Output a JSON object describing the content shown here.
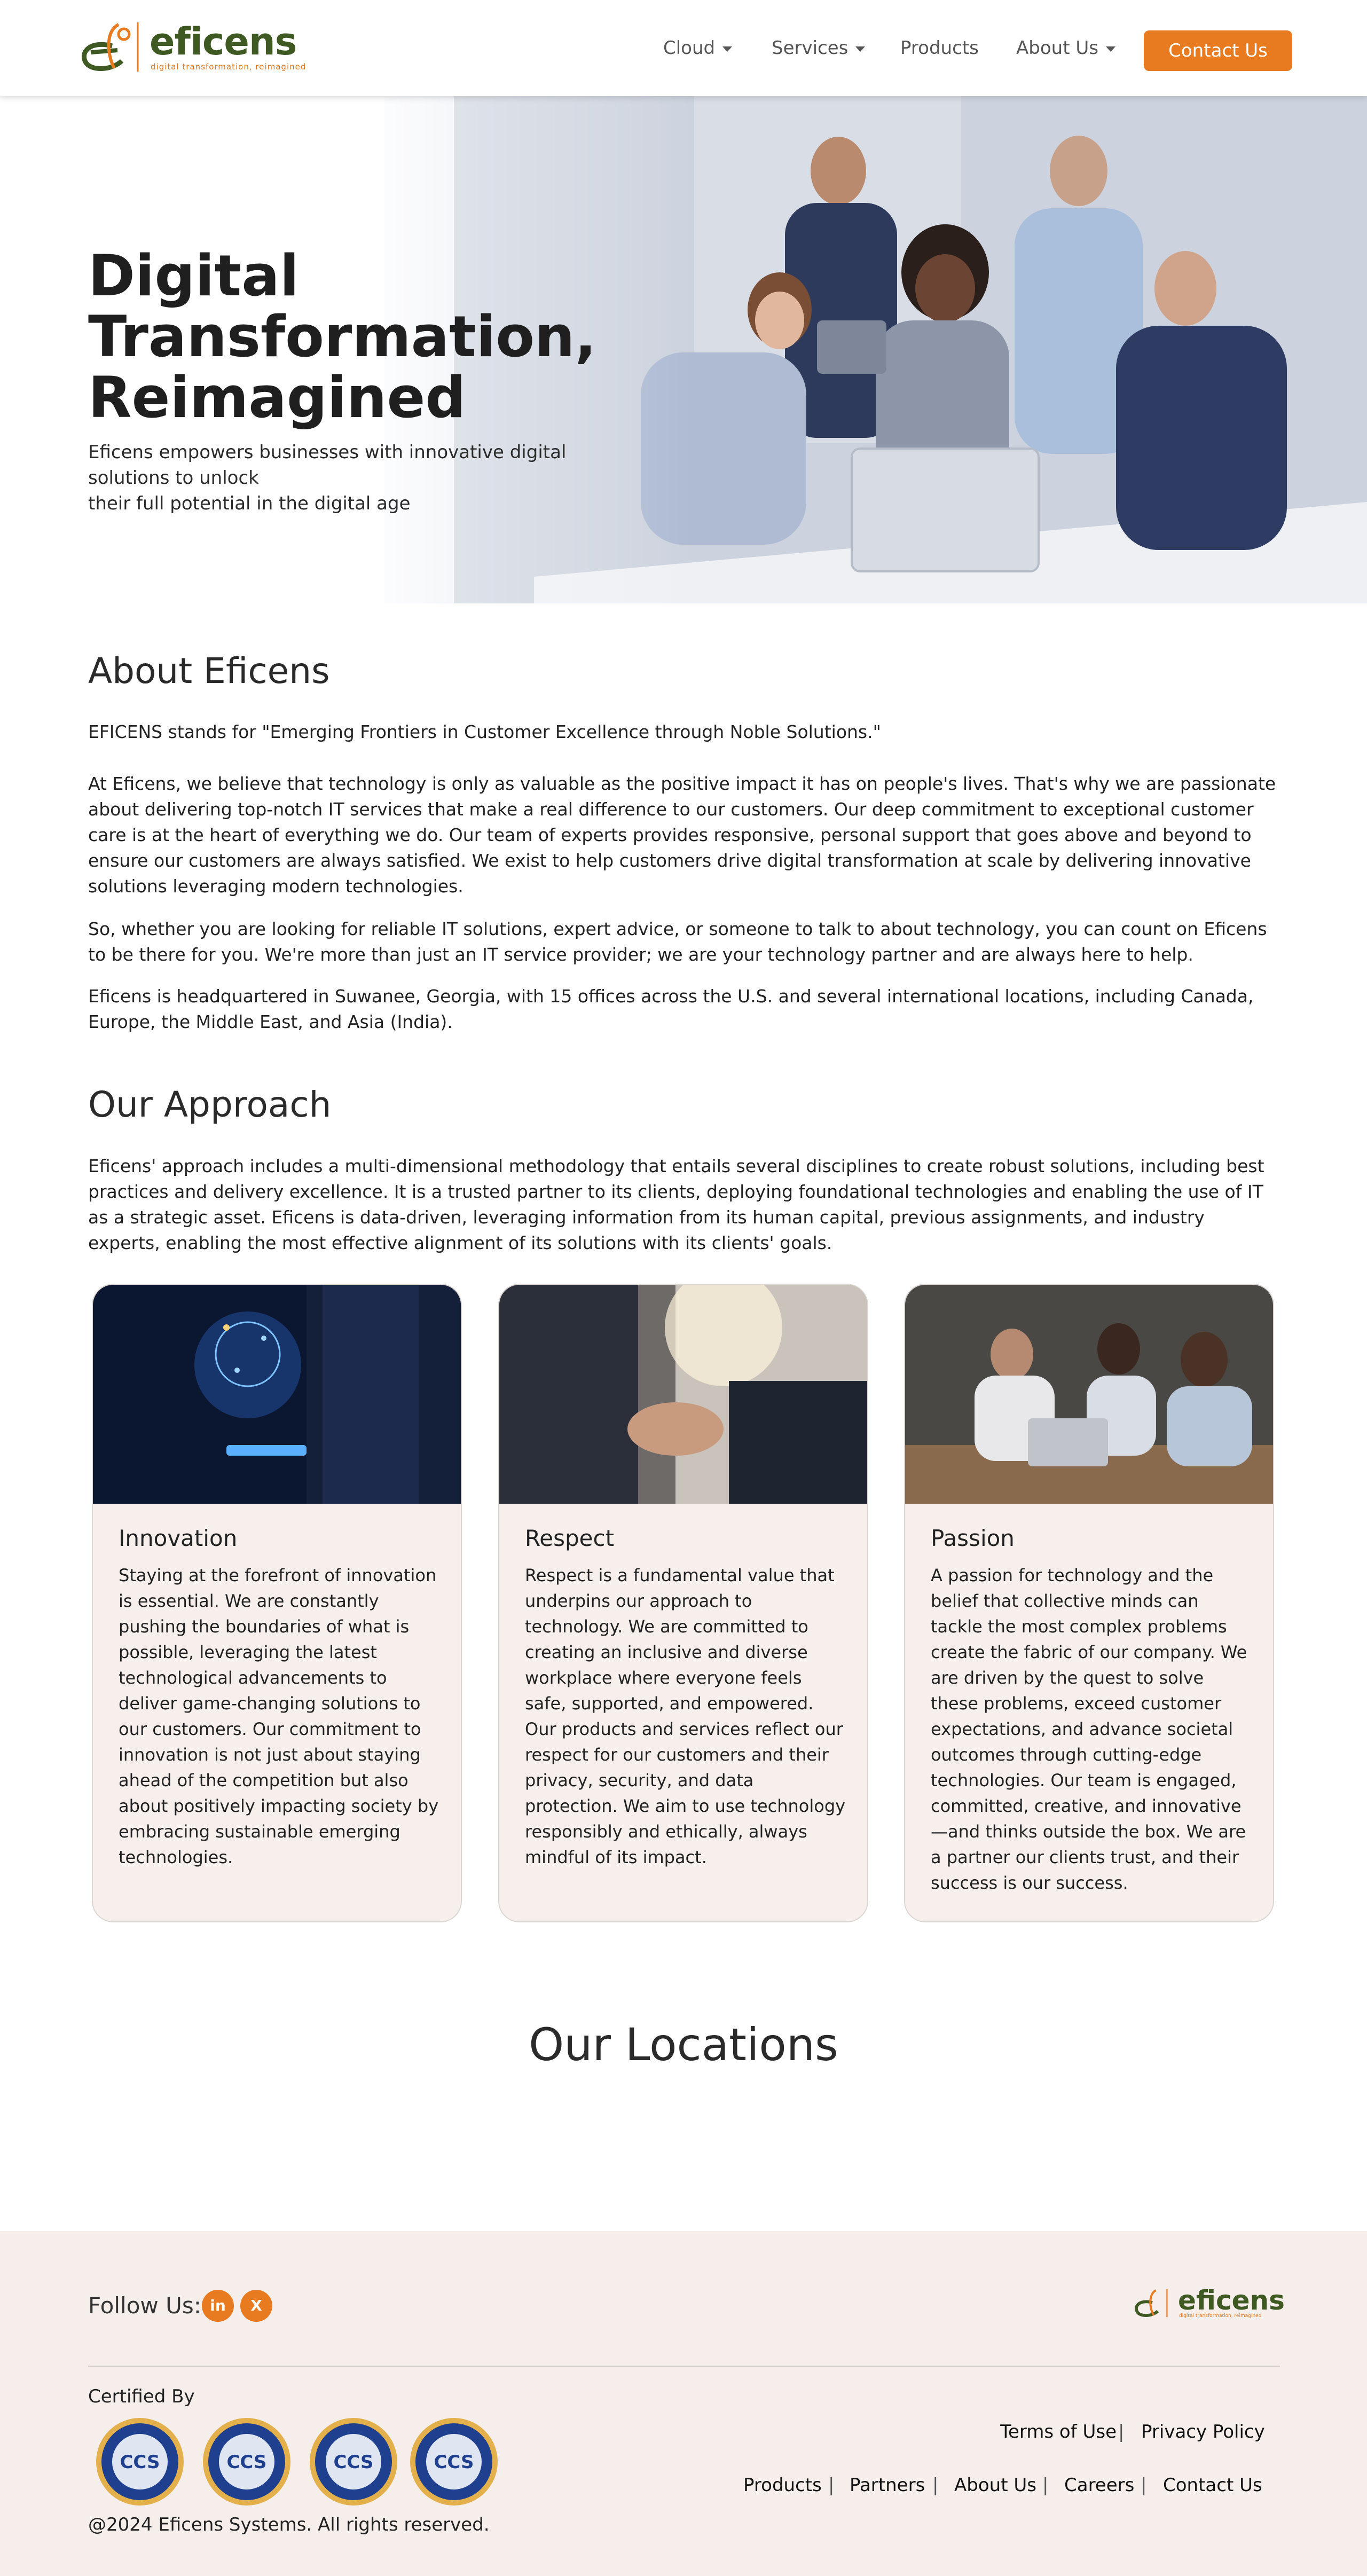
{
  "brand": {
    "name": "eficens",
    "tagline": "digital transformation, reimagined",
    "accent": "#e87a1f",
    "green": "#3e5a22"
  },
  "nav": {
    "items": [
      {
        "label": "Cloud",
        "dropdown": true
      },
      {
        "label": "Services",
        "dropdown": true
      },
      {
        "label": "Products",
        "dropdown": false
      },
      {
        "label": "About Us",
        "dropdown": true
      }
    ],
    "contact": "Contact Us"
  },
  "hero": {
    "title_line1": "Digital",
    "title_line2": "Transformation,",
    "title_line3": "Reimagined",
    "subtitle_line1": "Eficens empowers businesses with innovative digital solutions to unlock",
    "subtitle_line2": "their full potential in the digital age"
  },
  "about": {
    "heading": "About Eficens",
    "p1": "EFICENS stands for \"Emerging Frontiers in Customer Excellence through Noble Solutions.\"",
    "p2": "At Eficens, we believe that technology is only as valuable as the positive impact it has on people's lives. That's why we are passionate about delivering top-notch IT services that make a real difference to our customers. Our deep commitment to exceptional customer care is at the heart of everything we do. Our team of experts provides responsive, personal support that goes above and beyond to ensure our customers are always satisfied. We exist to help customers drive digital transformation at scale by delivering innovative solutions leveraging modern technologies.",
    "p3": "So, whether you are looking for reliable IT solutions, expert advice, or someone to talk to about technology, you can count on Eficens to be there for you. We're more than just an IT service provider; we are your technology partner and are always here to help.",
    "p4": "Eficens is headquartered in Suwanee, Georgia, with 15 offices across the U.S. and several international locations, including Canada, Europe, the Middle East, and Asia (India)."
  },
  "approach": {
    "heading": "Our Approach",
    "text": "Eficens' approach includes a multi-dimensional methodology that entails several disciplines to create robust solutions, including best practices and delivery excellence. It is a trusted partner to its clients, deploying foundational technologies and enabling the use of IT as a strategic asset. Eficens is data-driven, leveraging information from its human capital, previous assignments, and industry experts, enabling the most effective alignment of its solutions with its clients' goals.",
    "cards": [
      {
        "title": "Innovation",
        "text": "Staying at the forefront of innovation is essential. We are constantly pushing the boundaries of what is possible, leveraging the latest technological advancements to deliver game-changing solutions to our customers. Our commitment to innovation is not just about staying ahead of the competition but also about positively impacting society by embracing sustainable emerging technologies."
      },
      {
        "title": "Respect",
        "text": "Respect is a fundamental value that underpins our approach to technology. We are committed to creating an inclusive and diverse workplace where everyone feels safe, supported, and empowered. Our products and services reflect our respect for our customers and their privacy, security, and data protection. We aim to use technology responsibly and ethically, always mindful of its impact."
      },
      {
        "title": "Passion",
        "text": "A passion for technology and the belief that collective minds can tackle the most complex problems create the fabric of our company. We are driven by the quest to solve these problems, exceed customer expectations, and advance societal outcomes through cutting-edge technologies. Our team is engaged, committed, creative, and innovative—and thinks outside the box. We are a partner our clients trust, and their success is our success."
      }
    ]
  },
  "locations": {
    "heading": "Our Locations"
  },
  "footer": {
    "follow": "Follow Us:",
    "linkedin": "in",
    "x": "X",
    "certified": "Certified By",
    "badge_text": "CCS",
    "copyright": "@2024 Eficens Systems. All rights reserved.",
    "legal_links": [
      "Terms of Use",
      "Privacy Policy"
    ],
    "links": [
      "Products",
      "Partners",
      "About Us",
      "Careers",
      "Contact Us"
    ],
    "separator": "|"
  }
}
